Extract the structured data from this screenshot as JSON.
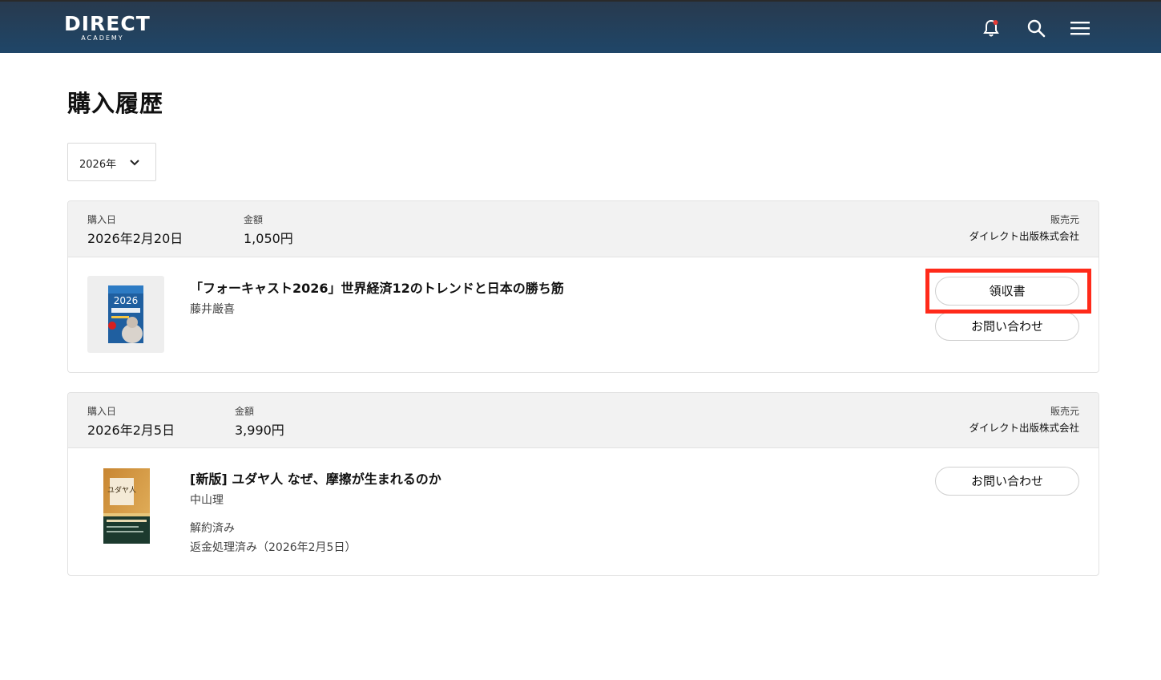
{
  "header": {
    "logo_main": "DIRECT",
    "logo_sub": "ACADEMY",
    "icons": [
      "bell-icon",
      "search-icon",
      "menu-icon"
    ],
    "notification_dot_color": "#e53935",
    "background_color": "#1f4668"
  },
  "page": {
    "title": "購入履歴"
  },
  "filter": {
    "year": "2026年"
  },
  "purchases": [
    {
      "date_label": "購入日",
      "date": "2026年2月20日",
      "amount_label": "金額",
      "amount": "1,050円",
      "seller_label": "販売元",
      "seller": "ダイレクト出版株式会社",
      "title": "「フォーキャスト2026」世界経済12のトレンドと日本の勝ち筋",
      "author": "藤井厳喜",
      "receipt_label": "領収書",
      "contact_label": "お問い合わせ",
      "cover_text": "2026"
    },
    {
      "date_label": "購入日",
      "date": "2026年2月5日",
      "amount_label": "金額",
      "amount": "3,990円",
      "seller_label": "販売元",
      "seller": "ダイレクト出版株式会社",
      "title": "[新版] ユダヤ人 なぜ、摩擦が生まれるのか",
      "author": "中山理",
      "status_cancel": "解約済み",
      "status_refund": "返金処理済み（2026年2月5日）",
      "contact_label": "お問い合わせ",
      "cover_text": "ユダヤ人"
    }
  ]
}
